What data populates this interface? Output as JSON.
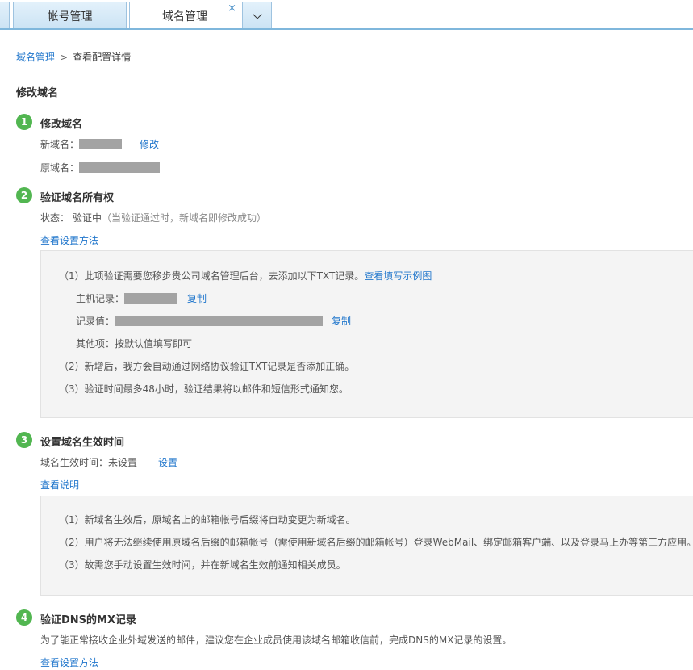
{
  "tabs": [
    {
      "label": "帐号管理"
    },
    {
      "label": "域名管理",
      "close": "×"
    }
  ],
  "breadcrumb": {
    "root": "域名管理",
    "separator": ">",
    "current": "查看配置详情"
  },
  "section_title": "修改域名",
  "step1": {
    "number": "1",
    "title": "修改域名",
    "new_label": "新域名：",
    "modify_link": "修改",
    "old_label": "原域名："
  },
  "step2": {
    "number": "2",
    "title": "验证域名所有权",
    "status_label": "状态：",
    "status_value": "验证中",
    "status_note": "（当验证通过时，新域名即修改成功）",
    "help_link": "查看设置方法",
    "panel": {
      "line1": "（1）此项验证需要您移步贵公司域名管理后台，去添加以下TXT记录。",
      "line1_link": "查看填写示例图",
      "host_label": "主机记录：",
      "copy1": "复制",
      "value_label": "记录值：",
      "copy2": "复制",
      "other": "其他项：按默认值填写即可",
      "line2": "（2）新增后，我方会自动通过网络协议验证TXT记录是否添加正确。",
      "line3": "（3）验证时间最多48小时，验证结果将以邮件和短信形式通知您。"
    }
  },
  "step3": {
    "number": "3",
    "title": "设置域名生效时间",
    "time_label": "域名生效时间：未设置",
    "set_link": "设置",
    "help_link": "查看说明",
    "panel": {
      "line1": "（1）新域名生效后，原域名上的邮箱帐号后缀将自动变更为新域名。",
      "line2": "（2）用户将无法继续使用原域名后缀的邮箱帐号（需使用新域名后缀的邮箱帐号）登录WebMail、绑定邮箱客户端、以及登录马上办等第三方应用。",
      "line3": "（3）故需您手动设置生效时间，并在新域名生效前通知相关成员。"
    }
  },
  "step4": {
    "number": "4",
    "title": "验证DNS的MX记录",
    "desc": "为了能正常接收企业外域发送的邮件，建议您在企业成员使用该域名邮箱收信前，完成DNS的MX记录的设置。",
    "help_link": "查看设置方法"
  }
}
